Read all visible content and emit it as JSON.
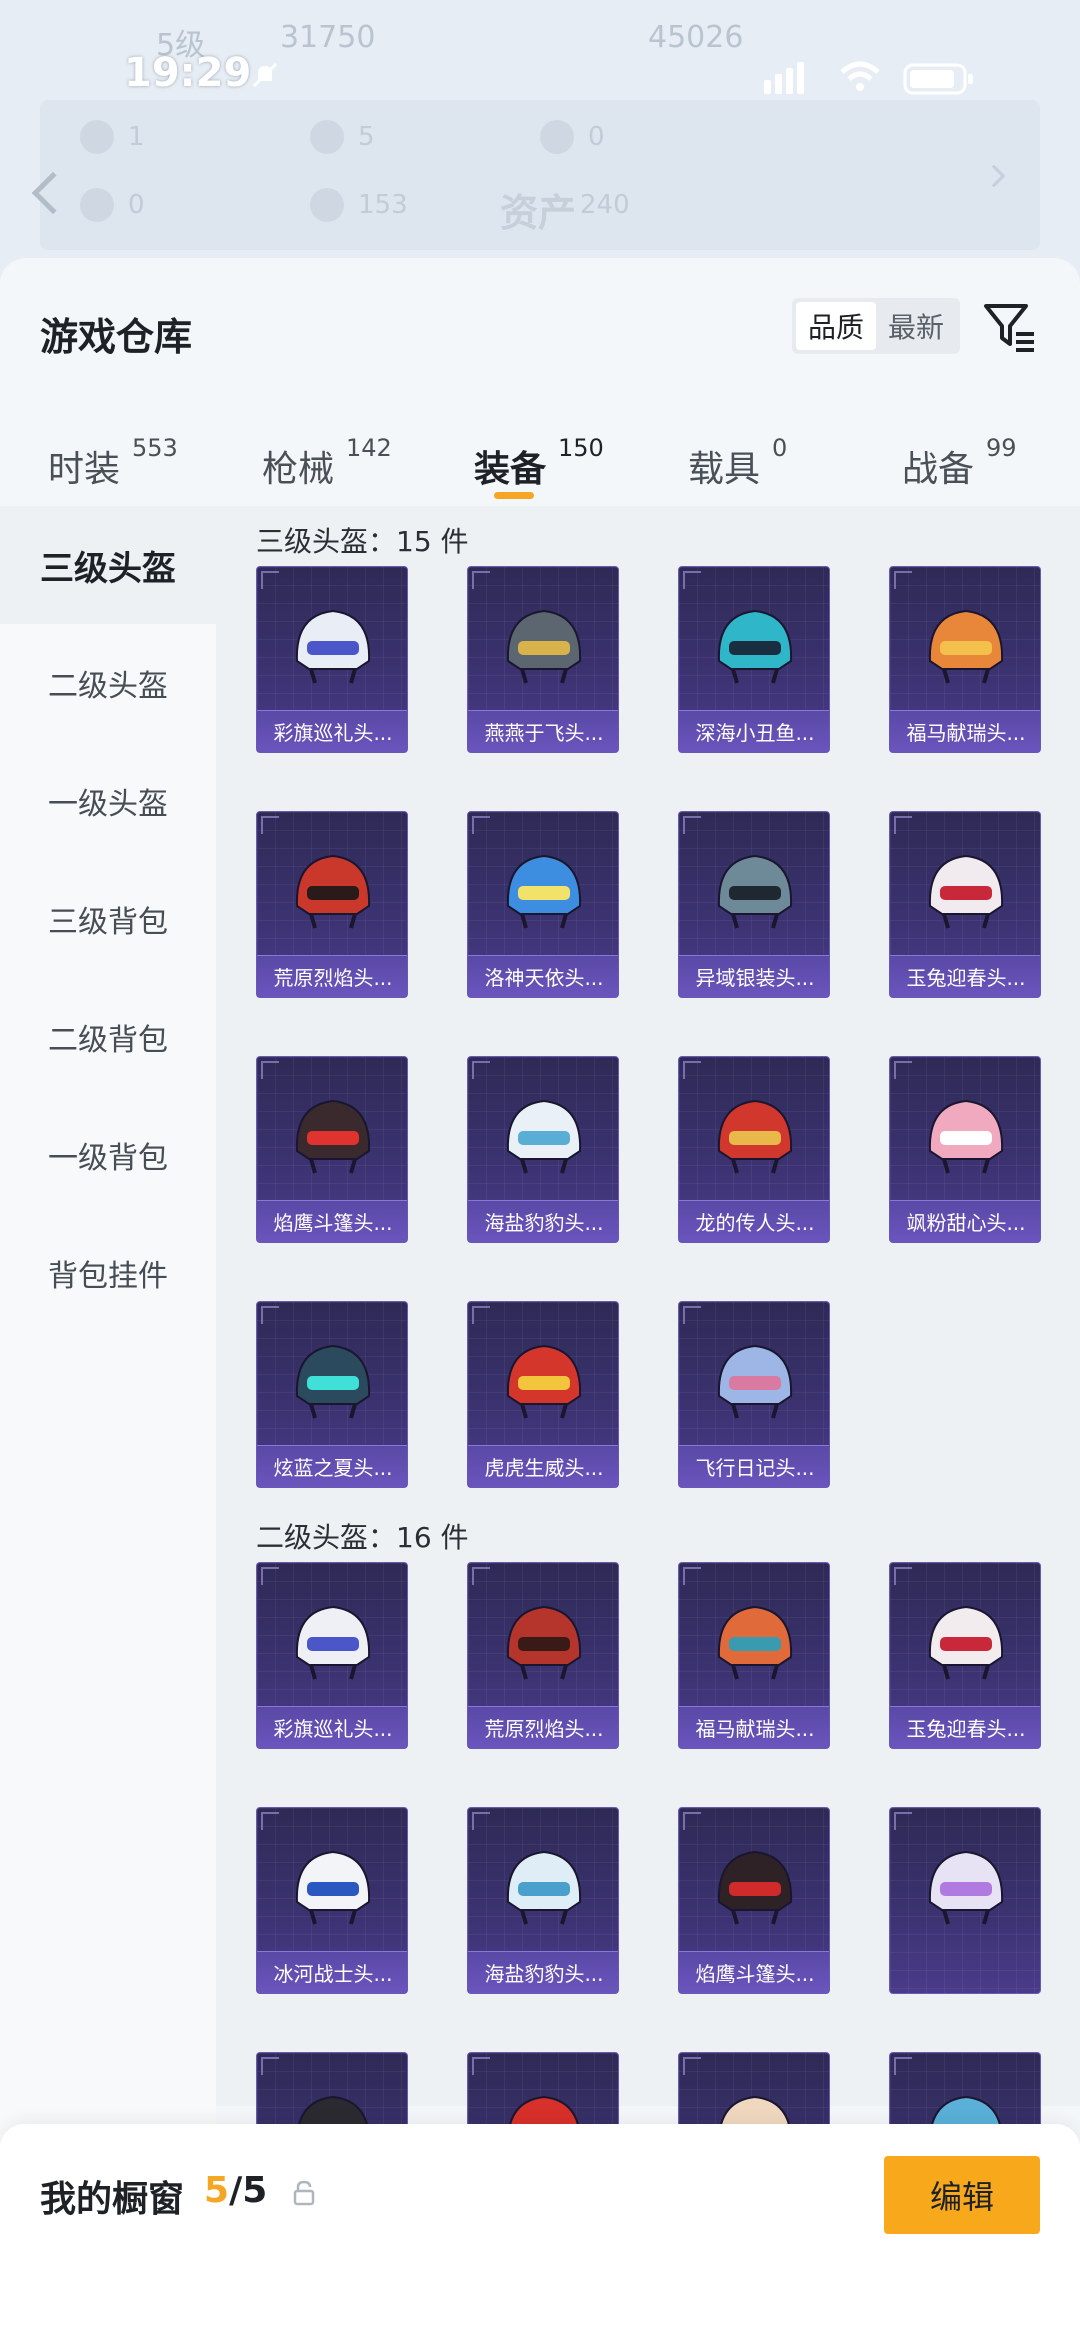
{
  "status_bar": {
    "time": "19:29"
  },
  "background": {
    "level": "5级",
    "score": "31750",
    "score2": "45026",
    "stats_row1": [
      "1",
      "5",
      "0"
    ],
    "stats_row2": [
      "0",
      "153",
      "240"
    ],
    "assets_label": "资产"
  },
  "header": {
    "title": "游戏仓库",
    "sort_options": [
      "品质",
      "最新"
    ],
    "sort_active": "品质"
  },
  "tabs": [
    {
      "label": "时装",
      "count": "553"
    },
    {
      "label": "枪械",
      "count": "142"
    },
    {
      "label": "装备",
      "count": "150",
      "active": true
    },
    {
      "label": "载具",
      "count": "0"
    },
    {
      "label": "战备",
      "count": "99"
    }
  ],
  "sidebar": {
    "items": [
      "三级头盔",
      "二级头盔",
      "一级头盔",
      "三级背包",
      "二级背包",
      "一级背包",
      "背包挂件"
    ],
    "active": "三级头盔"
  },
  "sections": [
    {
      "title": "三级头盔：15 件",
      "items": [
        {
          "name": "彩旗巡礼头...",
          "color": "#e9edf5",
          "accent": "#4b56c9"
        },
        {
          "name": "燕燕于飞头...",
          "color": "#5b6670",
          "accent": "#d8b24a"
        },
        {
          "name": "深海小丑鱼...",
          "color": "#2fb7c9",
          "accent": "#1b2d40"
        },
        {
          "name": "福马献瑞头...",
          "color": "#e8873a",
          "accent": "#f3c14b"
        },
        {
          "name": "荒原烈焰头...",
          "color": "#c9382b",
          "accent": "#2a1a1a"
        },
        {
          "name": "洛神天依头...",
          "color": "#3d8ee0",
          "accent": "#f2e26a"
        },
        {
          "name": "异域银装头...",
          "color": "#6e8a98",
          "accent": "#1f2830"
        },
        {
          "name": "玉兔迎春头...",
          "color": "#f1eaee",
          "accent": "#c8283a"
        },
        {
          "name": "焰鹰斗篷头...",
          "color": "#3a2a2e",
          "accent": "#e0322e"
        },
        {
          "name": "海盐豹豹头...",
          "color": "#e9f1f6",
          "accent": "#5aaed6"
        },
        {
          "name": "龙的传人头...",
          "color": "#d2372d",
          "accent": "#e8b84a"
        },
        {
          "name": "飒粉甜心头...",
          "color": "#f0a9bf",
          "accent": "#ffffff"
        },
        {
          "name": "炫蓝之夏头...",
          "color": "#2c4a5e",
          "accent": "#3fe0d8"
        },
        {
          "name": "虎虎生威头...",
          "color": "#d4362b",
          "accent": "#f2c53d"
        },
        {
          "name": "飞行日记头...",
          "color": "#9db6e6",
          "accent": "#d97aa2"
        }
      ]
    },
    {
      "title": "二级头盔：16 件",
      "items": [
        {
          "name": "彩旗巡礼头...",
          "color": "#eef0f6",
          "accent": "#4b56c9"
        },
        {
          "name": "荒原烈焰头...",
          "color": "#b5342b",
          "accent": "#3a1a16"
        },
        {
          "name": "福马献瑞头...",
          "color": "#e06a3a",
          "accent": "#3a9bb0"
        },
        {
          "name": "玉兔迎春头...",
          "color": "#f2ecef",
          "accent": "#c8283a"
        },
        {
          "name": "冰河战士头...",
          "color": "#f2f4f8",
          "accent": "#2b58c0"
        },
        {
          "name": "海盐豹豹头...",
          "color": "#dfeef6",
          "accent": "#4aa0cc"
        },
        {
          "name": "焰鹰斗篷头...",
          "color": "#2e2226",
          "accent": "#d02a2a"
        },
        {
          "name": "",
          "color": "#e7e2f4",
          "accent": "#b07ae0"
        },
        {
          "name": "",
          "color": "#2a2a30",
          "accent": "#555"
        },
        {
          "name": "",
          "color": "#d8302a",
          "accent": "#f2c53d"
        },
        {
          "name": "",
          "color": "#f0d8c0",
          "accent": "#f08aa0"
        },
        {
          "name": "",
          "color": "#5ab0d8",
          "accent": "#ffffff"
        }
      ]
    }
  ],
  "bottom_bar": {
    "title": "我的橱窗",
    "count_current": "5",
    "count_total": "/5",
    "edit_label": "编辑"
  }
}
